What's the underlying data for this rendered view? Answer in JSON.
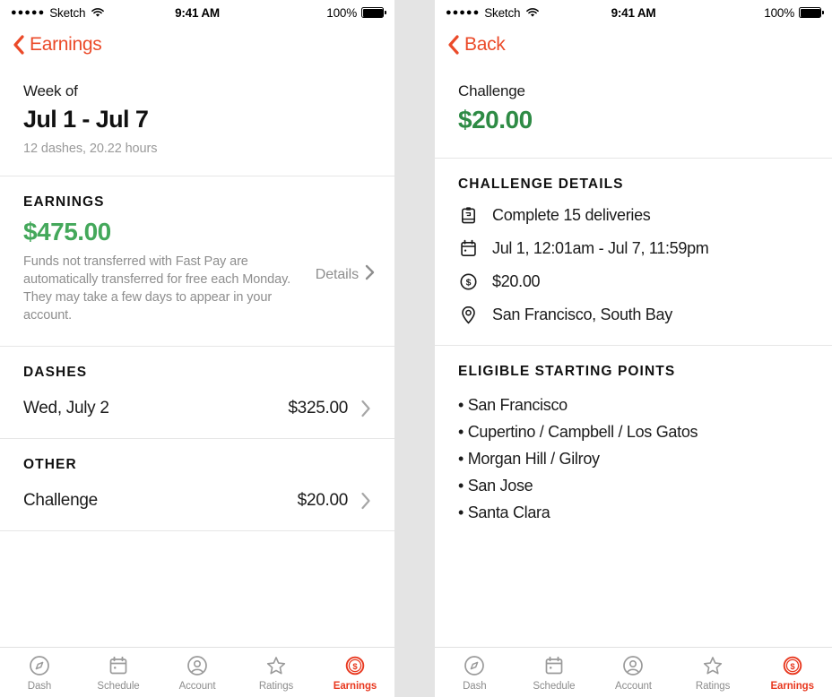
{
  "theme": {
    "accent_red": "#EB4A29",
    "tab_active_red": "#E8381F",
    "earnings_green": "#44A85B",
    "challenge_green": "#2E8B45",
    "muted_gray": "#8e8e8e",
    "background_gray": "#e4e4e4"
  },
  "status_bar": {
    "signal_dots": "●●●●●",
    "carrier": "Sketch",
    "wifi_icon": "wifi-icon",
    "time": "9:41 AM",
    "battery_percent": "100%",
    "battery_icon": "battery-full-icon"
  },
  "left_screen": {
    "nav": {
      "back_icon": "chevron-left-icon",
      "back_label": "Earnings"
    },
    "week": {
      "label": "Week of",
      "range": "Jul 1 - Jul 7",
      "meta": "12 dashes, 20.22 hours"
    },
    "earnings": {
      "heading": "EARNINGS",
      "amount": "$475.00",
      "note": "Funds not transferred with Fast Pay are automatically transferred for free each Monday. They may take a few days to appear in your account.",
      "details_label": "Details",
      "details_icon": "chevron-right-icon"
    },
    "dashes": {
      "heading": "DASHES",
      "rows": [
        {
          "label": "Wed, July 2",
          "amount": "$325.00",
          "chevron": "chevron-right-icon"
        }
      ]
    },
    "other": {
      "heading": "OTHER",
      "rows": [
        {
          "label": "Challenge",
          "amount": "$20.00",
          "chevron": "chevron-right-icon"
        }
      ]
    }
  },
  "right_screen": {
    "nav": {
      "back_icon": "chevron-left-icon",
      "back_label": "Back"
    },
    "header": {
      "title": "Challenge",
      "amount": "$20.00"
    },
    "details": {
      "heading": "CHALLENGE DETAILS",
      "rows": [
        {
          "icon": "clipboard-icon",
          "text": "Complete 15 deliveries"
        },
        {
          "icon": "calendar-icon",
          "text": "Jul 1, 12:01am - Jul 7, 11:59pm"
        },
        {
          "icon": "dollar-circle-icon",
          "text": "$20.00"
        },
        {
          "icon": "map-pin-icon",
          "text": "San Francisco, South Bay"
        }
      ]
    },
    "starting_points": {
      "heading": "ELIGIBLE STARTING POINTS",
      "items": [
        "• San Francisco",
        "• Cupertino / Campbell / Los Gatos",
        "• Morgan Hill / Gilroy",
        "• San Jose",
        "• Santa Clara"
      ]
    }
  },
  "tab_bar": {
    "tabs": [
      {
        "label": "Dash",
        "icon": "compass-icon",
        "active": false
      },
      {
        "label": "Schedule",
        "icon": "calendar-icon",
        "active": false
      },
      {
        "label": "Account",
        "icon": "person-circle-icon",
        "active": false
      },
      {
        "label": "Ratings",
        "icon": "star-icon",
        "active": false
      },
      {
        "label": "Earnings",
        "icon": "dollar-circle-icon",
        "active": true
      }
    ]
  }
}
